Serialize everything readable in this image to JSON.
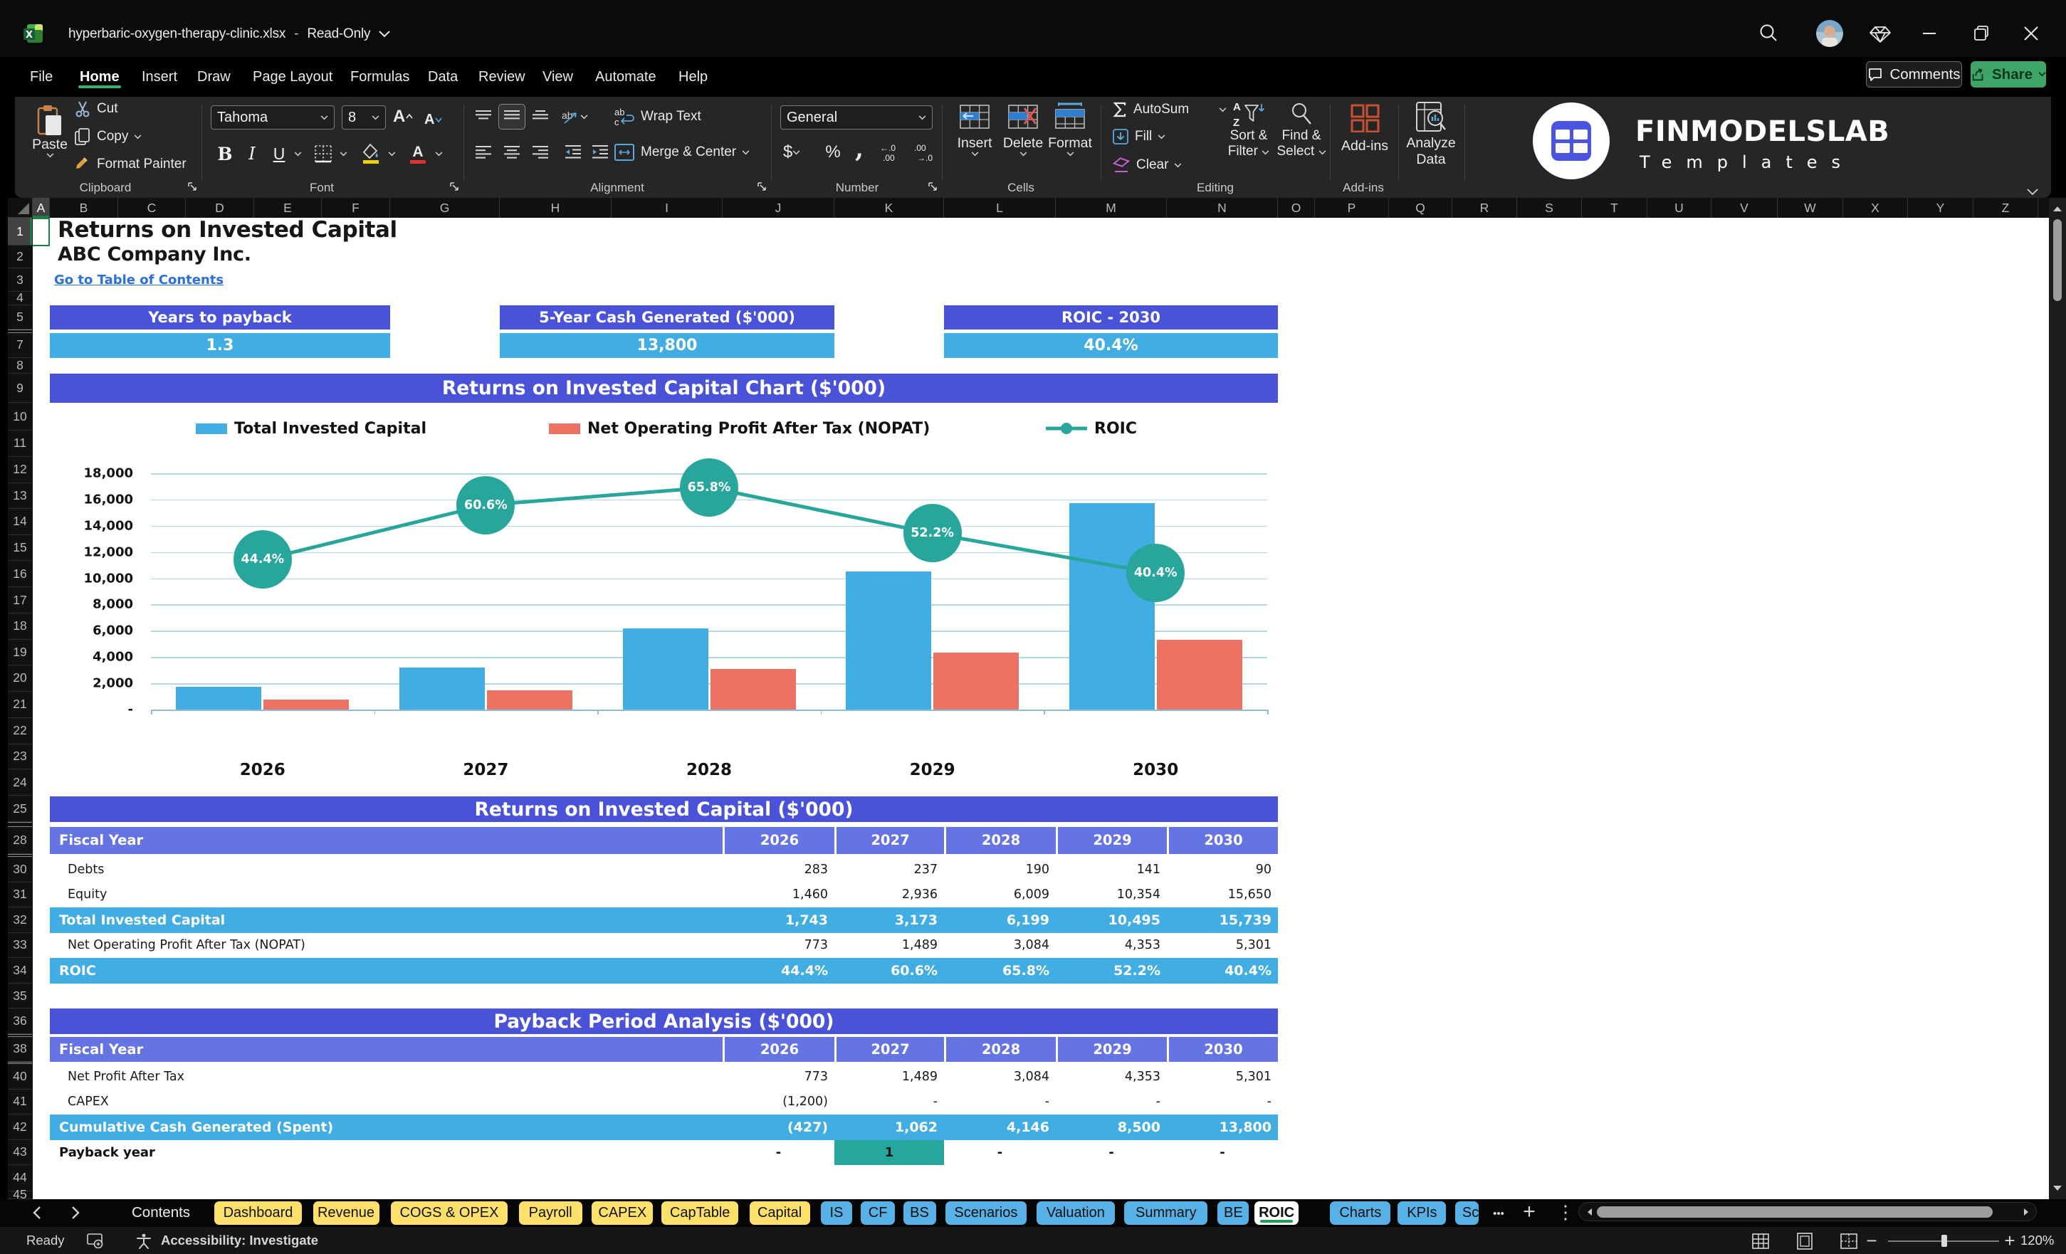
{
  "window": {
    "filename": "hyperbaric-oxygen-therapy-clinic.xlsx",
    "separator": "-",
    "mode": "Read-Only"
  },
  "menu": {
    "items": [
      "File",
      "Home",
      "Insert",
      "Draw",
      "Page Layout",
      "Formulas",
      "Data",
      "Review",
      "View",
      "Automate",
      "Help"
    ],
    "active": "Home"
  },
  "actions": {
    "comments": "Comments",
    "share": "Share"
  },
  "ribbon": {
    "clipboard": {
      "group": "Clipboard",
      "paste": "Paste",
      "cut": "Cut",
      "copy": "Copy",
      "format_painter": "Format Painter"
    },
    "font": {
      "group": "Font",
      "font_name": "Tahoma",
      "font_size": "8"
    },
    "alignment": {
      "group": "Alignment",
      "wrap_text": "Wrap Text",
      "merge_center": "Merge & Center"
    },
    "number": {
      "group": "Number",
      "format": "General"
    },
    "cells": {
      "group": "Cells",
      "insert": "Insert",
      "delete": "Delete",
      "format": "Format"
    },
    "editing": {
      "group": "Editing",
      "autosum": "AutoSum",
      "fill": "Fill",
      "clear": "Clear",
      "sort1": "Sort &",
      "sort2": "Filter",
      "find1": "Find &",
      "find2": "Select"
    },
    "addins": {
      "group": "Add-ins",
      "addins": "Add-ins",
      "analyze1": "Analyze",
      "analyze2": "Data"
    }
  },
  "logo": {
    "name": "FINMODELSLAB",
    "sub": "Templates",
    "sub_spaced": "T e m p l a t e s"
  },
  "grid": {
    "columns": [
      "A",
      "B",
      "C",
      "D",
      "E",
      "F",
      "G",
      "H",
      "I",
      "J",
      "K",
      "L",
      "M",
      "N",
      "O",
      "P",
      "Q",
      "R",
      "S",
      "T",
      "U",
      "V",
      "W",
      "X",
      "Y",
      "Z"
    ],
    "selected_column": "A",
    "selected_row": "1",
    "rows": [
      1,
      2,
      3,
      4,
      5,
      7,
      8,
      9,
      10,
      11,
      12,
      13,
      14,
      15,
      16,
      17,
      18,
      19,
      20,
      21,
      22,
      23,
      24,
      25,
      28,
      30,
      31,
      32,
      33,
      34,
      35,
      36,
      38,
      40,
      41,
      42,
      43,
      44,
      45
    ]
  },
  "sheet": {
    "title": "Returns on Invested Capital",
    "company": "ABC Company Inc.",
    "link": "Go to Table of Contents",
    "kpis": [
      {
        "label": "Years to payback",
        "value": "1.3"
      },
      {
        "label": "5-Year Cash Generated ($'000)",
        "value": "13,800"
      },
      {
        "label": "ROIC - 2030",
        "value": "40.4%"
      }
    ]
  },
  "chart_data": {
    "type": "bar+line",
    "title": "Returns on Invested Capital Chart ($'000)",
    "categories": [
      "2026",
      "2027",
      "2028",
      "2029",
      "2030"
    ],
    "series": [
      {
        "name": "Total Invested Capital",
        "type": "bar",
        "color": "#41ade3",
        "values": [
          1743,
          3173,
          6199,
          10495,
          15739
        ]
      },
      {
        "name": "Net Operating Profit After Tax (NOPAT)",
        "type": "bar",
        "color": "#ec7363",
        "values": [
          773,
          1489,
          3084,
          4353,
          5301
        ]
      },
      {
        "name": "ROIC",
        "type": "line",
        "color": "#28a69b",
        "values": [
          44.4,
          60.6,
          65.8,
          52.2,
          40.4
        ],
        "labels": [
          "44.4%",
          "60.6%",
          "65.8%",
          "52.2%",
          "40.4%"
        ],
        "axis": "secondary"
      }
    ],
    "ylim": [
      0,
      18000
    ],
    "ytick_step": 2000,
    "ytick_labels": [
      "-",
      "2,000",
      "4,000",
      "6,000",
      "8,000",
      "10,000",
      "12,000",
      "14,000",
      "16,000",
      "18,000"
    ],
    "secondary_ylim": [
      0,
      70
    ],
    "grid": "horizontal",
    "legend_position": "top"
  },
  "tables": [
    {
      "title": "Returns on Invested Capital ($'000)",
      "header": [
        "Fiscal Year",
        "2026",
        "2027",
        "2028",
        "2029",
        "2030"
      ],
      "rows": [
        {
          "label": "Debts",
          "style": "plain",
          "values": [
            "283",
            "237",
            "190",
            "141",
            "90"
          ]
        },
        {
          "label": "Equity",
          "style": "plain",
          "values": [
            "1,460",
            "2,936",
            "6,009",
            "10,354",
            "15,650"
          ]
        },
        {
          "label": "Total Invested Capital",
          "style": "blue",
          "values": [
            "1,743",
            "3,173",
            "6,199",
            "10,495",
            "15,739"
          ]
        },
        {
          "label": "Net Operating Profit After Tax (NOPAT)",
          "style": "plain",
          "values": [
            "773",
            "1,489",
            "3,084",
            "4,353",
            "5,301"
          ]
        },
        {
          "label": "ROIC",
          "style": "blue",
          "values": [
            "44.4%",
            "60.6%",
            "65.8%",
            "52.2%",
            "40.4%"
          ]
        }
      ]
    },
    {
      "title": "Payback Period Analysis ($'000)",
      "header": [
        "Fiscal Year",
        "2026",
        "2027",
        "2028",
        "2029",
        "2030"
      ],
      "rows": [
        {
          "label": "Net Profit After Tax",
          "style": "plain",
          "values": [
            "773",
            "1,489",
            "3,084",
            "4,353",
            "5,301"
          ]
        },
        {
          "label": "CAPEX",
          "style": "plain",
          "values": [
            "(1,200)",
            "-",
            "-",
            "-",
            "-"
          ]
        },
        {
          "label": "Cumulative Cash Generated (Spent)",
          "style": "blue",
          "values": [
            "(427)",
            "1,062",
            "4,146",
            "8,500",
            "13,800"
          ]
        },
        {
          "label": "Payback year",
          "style": "payback",
          "values": [
            "-",
            "1",
            "-",
            "-",
            "-"
          ],
          "highlight_index": 1
        }
      ]
    }
  ],
  "tabs": {
    "first": "Contents",
    "list": [
      {
        "label": "Dashboard",
        "color": "yellow"
      },
      {
        "label": "Revenue",
        "color": "yellow"
      },
      {
        "label": "COGS & OPEX",
        "color": "yellow"
      },
      {
        "label": "Payroll",
        "color": "yellow"
      },
      {
        "label": "CAPEX",
        "color": "yellow"
      },
      {
        "label": "CapTable",
        "color": "yellow"
      },
      {
        "label": "Capital",
        "color": "yellow"
      },
      {
        "label": "IS",
        "color": "blue"
      },
      {
        "label": "CF",
        "color": "blue"
      },
      {
        "label": "BS",
        "color": "blue"
      },
      {
        "label": "Scenarios",
        "color": "blue"
      },
      {
        "label": "Valuation",
        "color": "blue"
      },
      {
        "label": "Summary",
        "color": "blue"
      },
      {
        "label": "BE",
        "color": "blue"
      },
      {
        "label": "ROIC",
        "color": "active"
      },
      {
        "label": "Charts",
        "color": "blue"
      },
      {
        "label": "KPIs",
        "color": "blue"
      },
      {
        "label": "Sc",
        "color": "blue clip"
      }
    ]
  },
  "statusbar": {
    "ready": "Ready",
    "accessibility": "Accessibility: Investigate",
    "zoom": "120%"
  }
}
